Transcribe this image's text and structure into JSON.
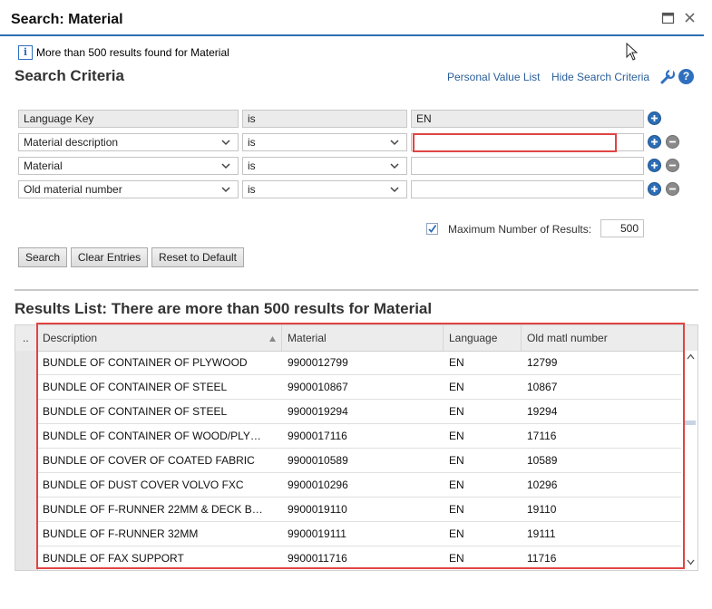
{
  "window": {
    "title": "Search: Material"
  },
  "message": "More than 500 results found for Material",
  "criteria": {
    "heading": "Search Criteria",
    "personal_value_list": "Personal Value List",
    "hide_search_criteria": "Hide Search Criteria",
    "rows": [
      {
        "field": "Language Key",
        "operator": "is",
        "value": "EN",
        "readonly": true
      },
      {
        "field": "Material description",
        "operator": "is",
        "value": "",
        "readonly": false
      },
      {
        "field": "Material",
        "operator": "is",
        "value": "",
        "readonly": false
      },
      {
        "field": "Old material number",
        "operator": "is",
        "value": "",
        "readonly": false
      }
    ],
    "max_results_label": "Maximum Number of Results:",
    "max_results_value": "500",
    "max_results_checked": true
  },
  "buttons": {
    "search": "Search",
    "clear": "Clear Entries",
    "reset": "Reset to Default"
  },
  "results": {
    "heading": "Results List: There are more than 500 results for Material",
    "rowsel_header": "..",
    "columns": [
      "Description",
      "Material",
      "Language",
      "Old matl number"
    ],
    "rows": [
      [
        "BUNDLE OF CONTAINER OF PLYWOOD",
        "9900012799",
        "EN",
        "12799"
      ],
      [
        "BUNDLE OF CONTAINER OF STEEL",
        "9900010867",
        "EN",
        "10867"
      ],
      [
        "BUNDLE OF CONTAINER OF STEEL",
        "9900019294",
        "EN",
        "19294"
      ],
      [
        "BUNDLE OF CONTAINER OF WOOD/PLY…",
        "9900017116",
        "EN",
        "17116"
      ],
      [
        "BUNDLE OF COVER OF COATED FABRIC",
        "9900010589",
        "EN",
        "10589"
      ],
      [
        "BUNDLE OF DUST COVER VOLVO FXC",
        "9900010296",
        "EN",
        "10296"
      ],
      [
        "BUNDLE OF F-RUNNER 22MM & DECK B…",
        "9900019110",
        "EN",
        "19110"
      ],
      [
        "BUNDLE OF F-RUNNER 32MM",
        "9900019111",
        "EN",
        "19111"
      ],
      [
        "BUNDLE OF FAX SUPPORT",
        "9900011716",
        "EN",
        "11716"
      ]
    ]
  },
  "colors": {
    "accent": "#2b6fb2",
    "link": "#2a5e9a",
    "highlight": "#e04444"
  }
}
